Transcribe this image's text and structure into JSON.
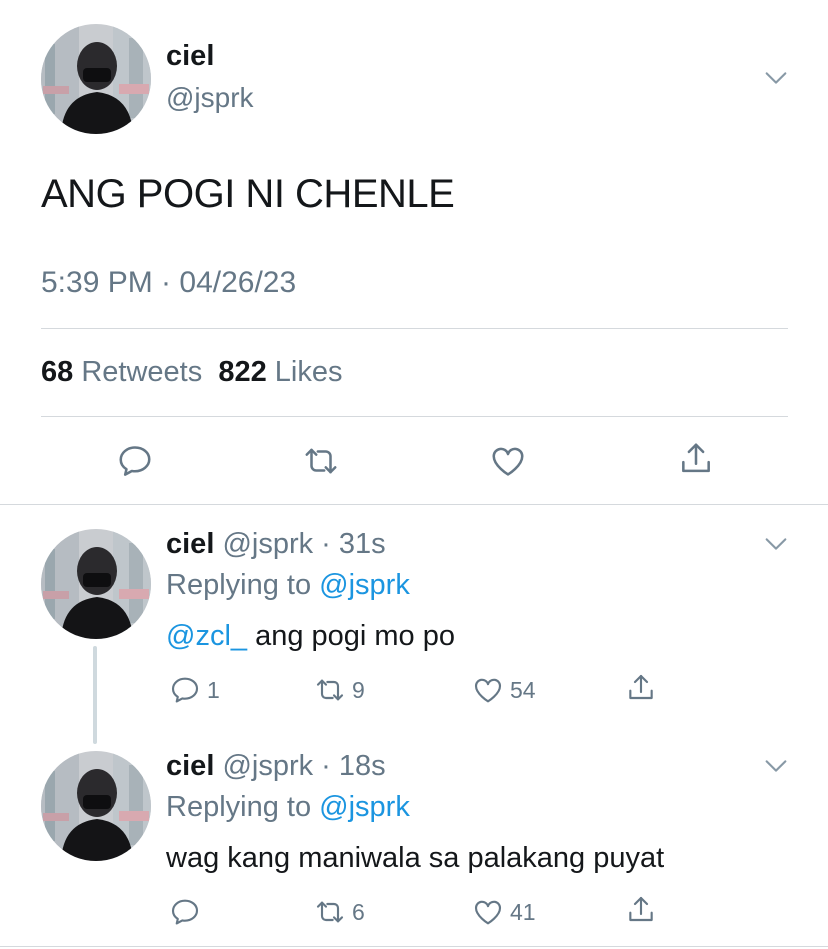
{
  "main": {
    "name": "ciel",
    "handle": "@jsprk",
    "text": "ANG POGI NI CHENLE",
    "timestamp": "5:39 PM · 04/26/23",
    "retweets_count": "68",
    "retweets_label": "Retweets",
    "likes_count": "822",
    "likes_label": "Likes"
  },
  "replies": [
    {
      "name": "ciel",
      "handle_time": "@jsprk · 31s",
      "replying_prefix": "Replying to",
      "replying_handle": "@jsprk",
      "mention": "@zcl_",
      "text": " ang pogi mo po",
      "replies": "1",
      "retweets": "9",
      "likes": "54"
    },
    {
      "name": "ciel",
      "handle_time": "@jsprk · 18s",
      "replying_prefix": "Replying to",
      "replying_handle": "@jsprk",
      "text": "wag kang maniwala sa palakang puyat",
      "retweets": "6",
      "likes": "41"
    }
  ],
  "icons": [
    "reply-icon",
    "retweet-icon",
    "like-icon",
    "share-icon",
    "chevron-down-icon"
  ],
  "colors": {
    "text": "#14171a",
    "secondary": "#657786",
    "link": "#1b95e0",
    "divider": "#d5d9dd"
  }
}
